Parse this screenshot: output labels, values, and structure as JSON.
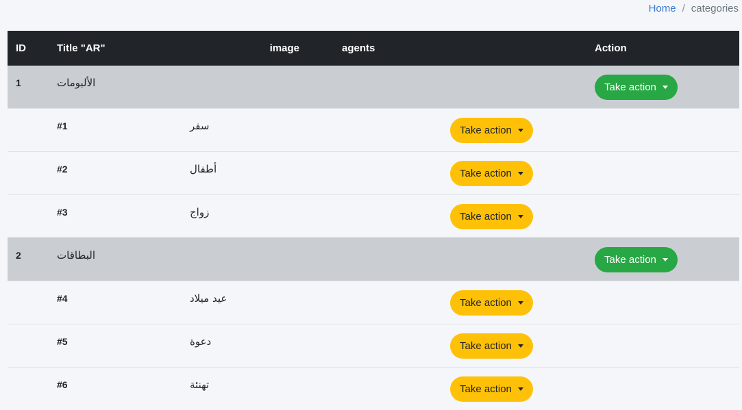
{
  "breadcrumb": {
    "home": "Home",
    "separator": "/",
    "current": "categories"
  },
  "table": {
    "headers": {
      "id": "ID",
      "title": "Title \"AR\"",
      "image": "image",
      "agents": "agents",
      "action": "Action"
    },
    "groups": [
      {
        "id": "1",
        "title": "الألبومات",
        "action_label": "Take action",
        "children": [
          {
            "num": "#1",
            "name": "سفر",
            "action_label": "Take action"
          },
          {
            "num": "#2",
            "name": "أطفال",
            "action_label": "Take action"
          },
          {
            "num": "#3",
            "name": "زواج",
            "action_label": "Take action"
          }
        ]
      },
      {
        "id": "2",
        "title": "البطاقات",
        "action_label": "Take action",
        "children": [
          {
            "num": "#4",
            "name": "عيد ميلاد",
            "action_label": "Take action"
          },
          {
            "num": "#5",
            "name": "دعوة",
            "action_label": "Take action"
          },
          {
            "num": "#6",
            "name": "تهنئة",
            "action_label": "Take action"
          }
        ]
      }
    ]
  },
  "colors": {
    "header_bg": "#212529",
    "parent_row_bg": "#caced3",
    "child_row_bg": "#f4f6f9",
    "green_button": "#28a745",
    "yellow_button": "#ffc107",
    "link": "#3a7bd5"
  }
}
